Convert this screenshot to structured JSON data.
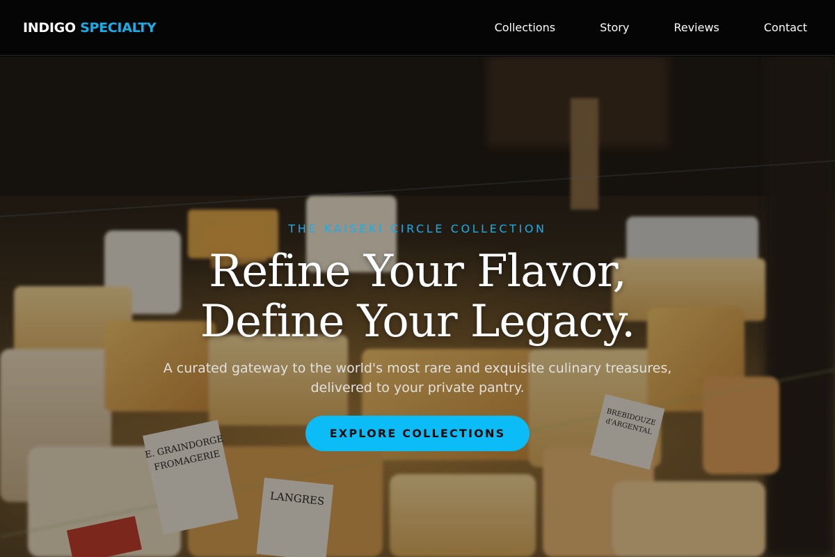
{
  "brand": {
    "name_primary": "INDIGO",
    "name_accent": "SPECIALTY",
    "accent_color": "#19aee8"
  },
  "nav": {
    "items": [
      {
        "label": "Collections"
      },
      {
        "label": "Story"
      },
      {
        "label": "Reviews"
      },
      {
        "label": "Contact"
      }
    ]
  },
  "hero": {
    "eyebrow": "THE KAISEKI CIRCLE COLLECTION",
    "headline_line1": "Refine Your Flavor,",
    "headline_line2": "Define Your Legacy.",
    "subtitle_line1": "A curated gateway to the world's most rare and exquisite culinary treasures,",
    "subtitle_line2": "delivered to your private pantry.",
    "cta_label": "EXPLORE COLLECTIONS",
    "cta_color": "#0bbcf7",
    "background_image": "cheese-display-photo",
    "photo_labels": {
      "label1": "E. GRAINDORGE",
      "label1b": "FROMAGERIE",
      "label2": "LANGRES",
      "label3": "BREBIDOUZE",
      "label3b": "d'ARGENTAL"
    }
  }
}
